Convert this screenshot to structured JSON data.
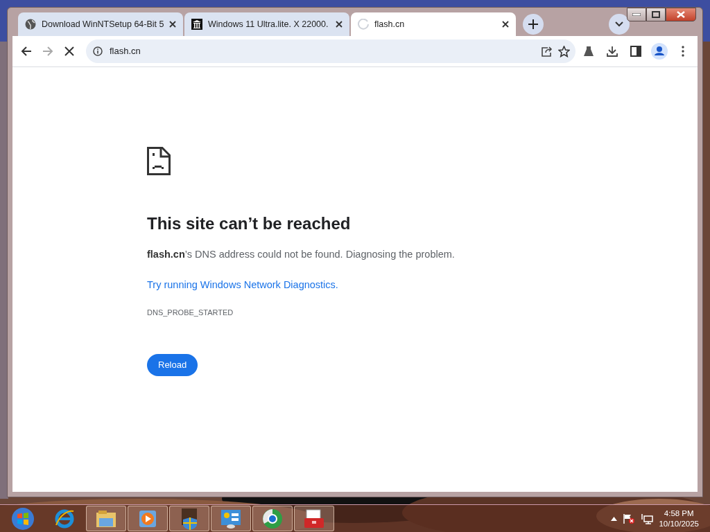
{
  "tabs": [
    {
      "title": "Download WinNTSetup 64-Bit 5",
      "selected": false,
      "loading": false
    },
    {
      "title": "Windows 11 Ultra.lite. X 22000.",
      "selected": false,
      "loading": false
    },
    {
      "title": "flash.cn",
      "selected": true,
      "loading": true
    }
  ],
  "address_bar": {
    "value": "flash.cn"
  },
  "error_page": {
    "heading": "This site can’t be reached",
    "message": "**flash.cn**’s DNS address could not be found. Diagnosing the problem.",
    "link": "Try running Windows Network Diagnostics.",
    "error_code": "DNS_PROBE_STARTED",
    "button": "Reload"
  },
  "taskbar": {
    "apps": [
      {
        "running": false
      },
      {
        "running": false
      },
      {
        "running": true
      },
      {
        "running": true
      },
      {
        "running": true
      },
      {
        "running": true
      },
      {
        "running": true
      },
      {
        "running": true
      }
    ],
    "clock": {
      "time": "4:58 PM",
      "date": "10/10/2025"
    }
  }
}
